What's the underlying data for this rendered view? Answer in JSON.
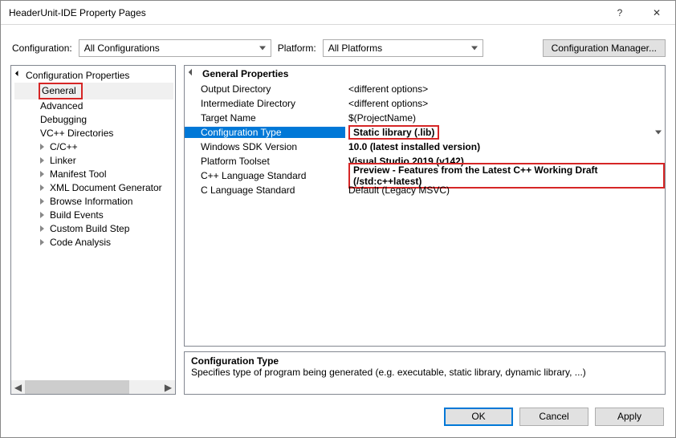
{
  "title": "HeaderUnit-IDE Property Pages",
  "configRow": {
    "configLabel": "Configuration:",
    "configValue": "All Configurations",
    "platformLabel": "Platform:",
    "platformValue": "All Platforms",
    "managerBtn": "Configuration Manager..."
  },
  "tree": {
    "root": "Configuration Properties",
    "items": [
      "General",
      "Advanced",
      "Debugging",
      "VC++ Directories",
      "C/C++",
      "Linker",
      "Manifest Tool",
      "XML Document Generator",
      "Browse Information",
      "Build Events",
      "Custom Build Step",
      "Code Analysis"
    ]
  },
  "grid": {
    "header": "General Properties",
    "rows": [
      {
        "label": "Output Directory",
        "value": "<different options>"
      },
      {
        "label": "Intermediate Directory",
        "value": "<different options>"
      },
      {
        "label": "Target Name",
        "value": "$(ProjectName)"
      },
      {
        "label": "Configuration Type",
        "value": "Static library (.lib)"
      },
      {
        "label": "Windows SDK Version",
        "value": "10.0 (latest installed version)"
      },
      {
        "label": "Platform Toolset",
        "value": "Visual Studio 2019 (v142)"
      },
      {
        "label": "C++ Language Standard",
        "value": "Preview - Features from the Latest C++ Working Draft (/std:c++latest)"
      },
      {
        "label": "C Language Standard",
        "value": "Default (Legacy MSVC)"
      }
    ]
  },
  "desc": {
    "title": "Configuration Type",
    "text": "Specifies type of program being generated (e.g. executable, static library, dynamic library, ...)"
  },
  "footer": {
    "ok": "OK",
    "cancel": "Cancel",
    "apply": "Apply"
  },
  "glyphs": {
    "help": "?",
    "close": "✕",
    "left": "◀",
    "right": "▶"
  }
}
